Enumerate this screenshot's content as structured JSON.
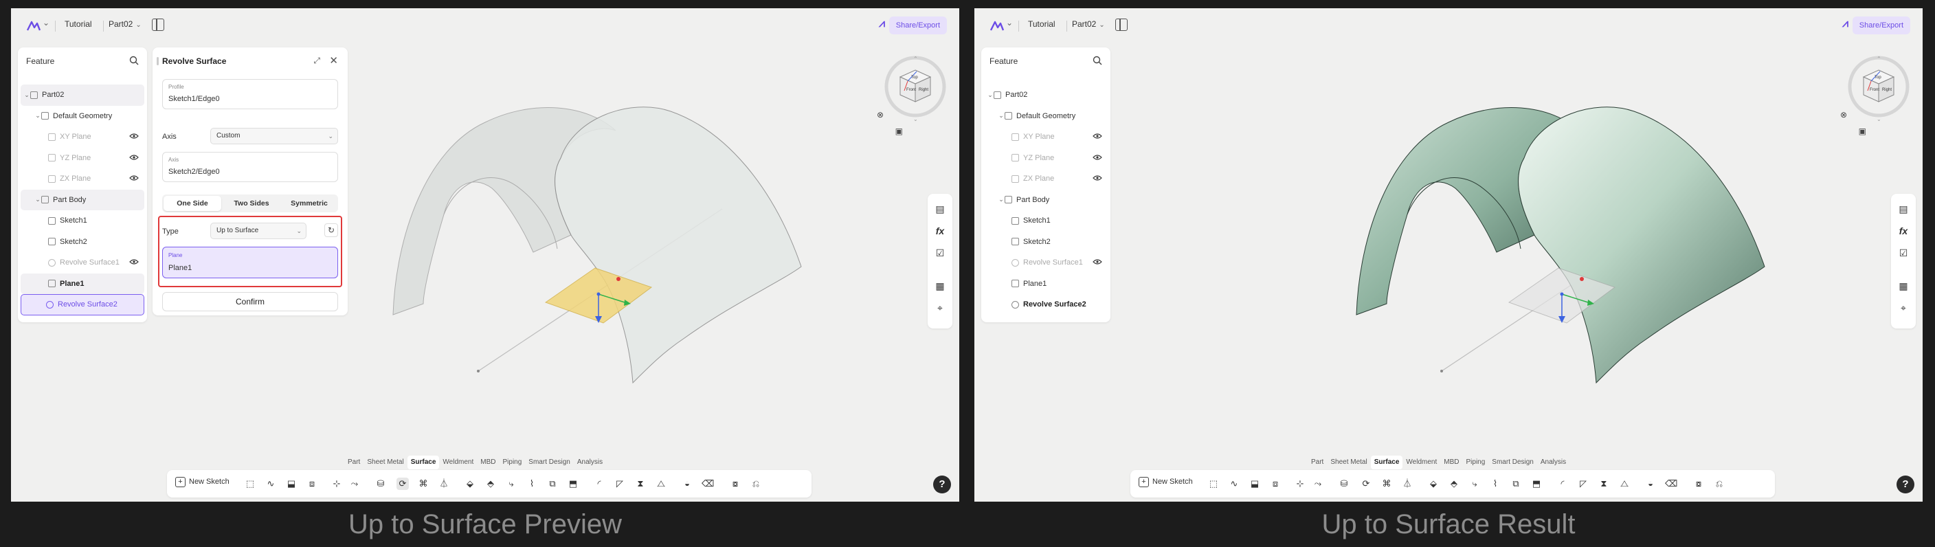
{
  "colors": {
    "accent": "#6c4de6",
    "accent_light": "#ece6fd",
    "highlight_red": "#e0393a",
    "axis_red": "#e0393a",
    "axis_green": "#2fb34a",
    "axis_blue": "#3d63e0",
    "plane_yellow": "#f1d57a",
    "surface_green": "#a9cbb8"
  },
  "icons": {
    "logo": "brand-logo-icon",
    "search": "search-icon",
    "eye": "eye-icon",
    "layout": "sidebar-toggle-icon",
    "close": "close-icon",
    "help": "help-icon"
  },
  "topbar": {
    "breadcrumb_tutorial": "Tutorial",
    "breadcrumb_part": "Part02",
    "share_label": "Share/Export"
  },
  "feature_panel": {
    "title": "Feature",
    "items": [
      {
        "label": "Part02"
      },
      {
        "label": "Default Geometry"
      },
      {
        "label": "XY Plane"
      },
      {
        "label": "YZ Plane"
      },
      {
        "label": "ZX Plane"
      },
      {
        "label": "Part Body"
      },
      {
        "label": "Sketch1"
      },
      {
        "label": "Sketch2"
      },
      {
        "label": "Revolve Surface1"
      },
      {
        "label": "Plane1"
      },
      {
        "label": "Revolve Surface2"
      }
    ]
  },
  "revolve": {
    "title": "Revolve Surface",
    "profile_label": "Profile",
    "profile_value": "Sketch1/Edge0",
    "axis_label": "Axis",
    "axis_select": "Custom",
    "axis_field_label": "Axis",
    "axis_field_value": "Sketch2/Edge0",
    "tabs": [
      "One Side",
      "Two Sides",
      "Symmetric"
    ],
    "type_label": "Type",
    "type_value": "Up to Surface",
    "plane_label": "Plane",
    "plane_value": "Plane1",
    "confirm_label": "Confirm"
  },
  "viewcube": {
    "faces": [
      "Front",
      "Right",
      "Top"
    ]
  },
  "side_tools": {
    "fx_label": "fx"
  },
  "ribbon": {
    "modes": [
      "Part",
      "Sheet Metal",
      "Surface",
      "Weldment",
      "MBD",
      "Piping",
      "Smart Design",
      "Analysis"
    ],
    "active_mode": "Surface",
    "new_sketch": "New Sketch"
  },
  "captions": {
    "left": "Up to Surface Preview",
    "right": "Up to Surface Result"
  }
}
